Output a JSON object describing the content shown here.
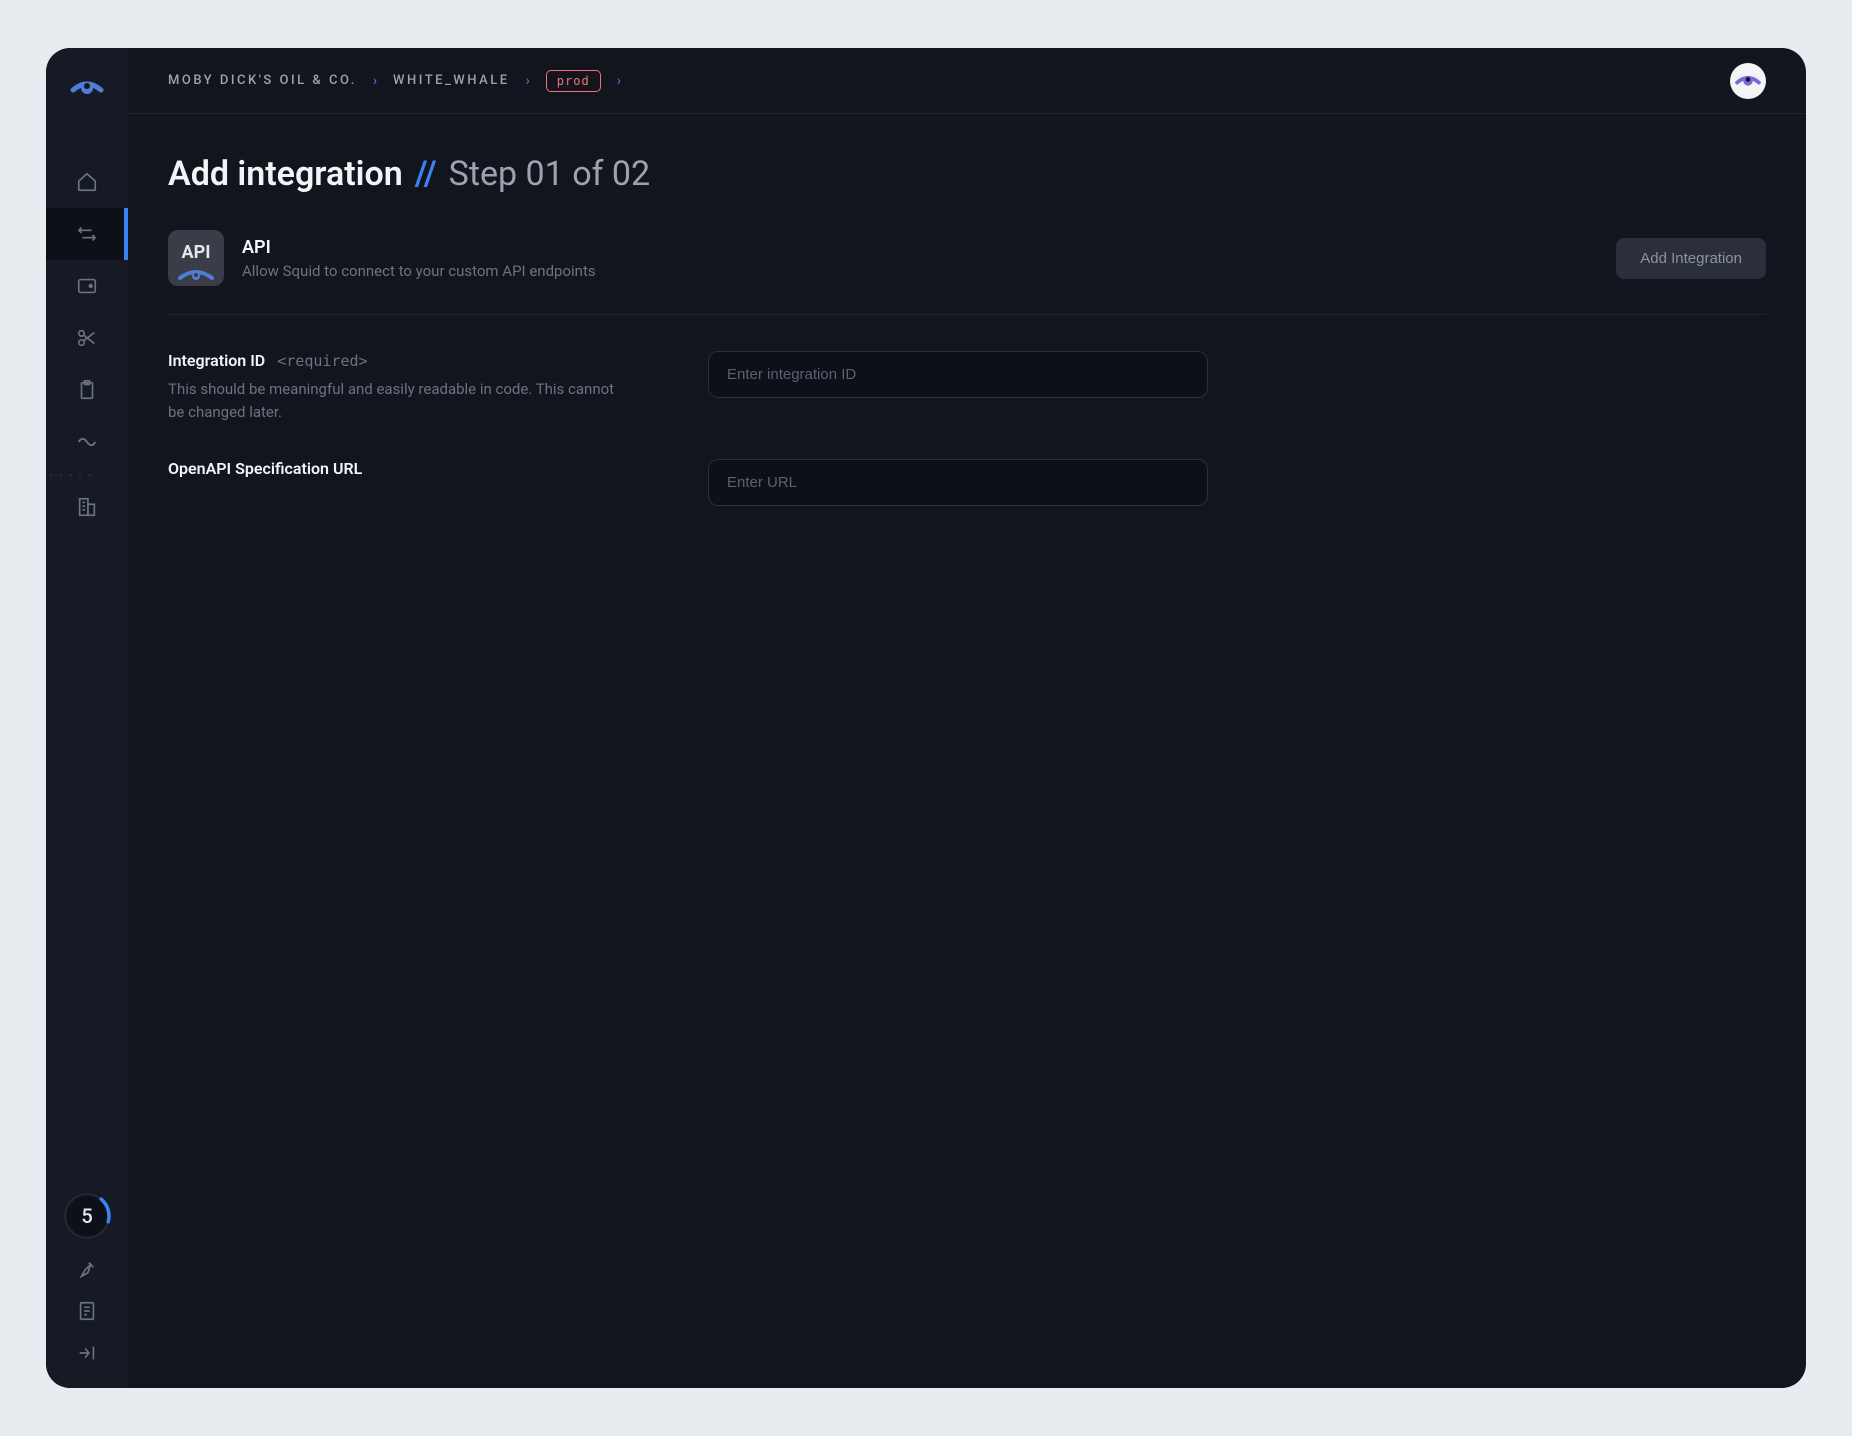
{
  "breadcrumb": {
    "org": "MOBY DICK'S OIL & CO.",
    "project": "WHITE_WHALE",
    "env": "prod"
  },
  "page": {
    "title": "Add integration",
    "step": "Step 01 of 02"
  },
  "integration": {
    "iconLabel": "API",
    "name": "API",
    "description": "Allow Squid to connect to your custom API endpoints",
    "addButton": "Add Integration"
  },
  "fields": {
    "integrationId": {
      "label": "Integration ID",
      "required": "<required>",
      "description": "This should be meaningful and easily readable in code. This cannot be changed later.",
      "placeholder": "Enter integration ID"
    },
    "openApiUrl": {
      "label": "OpenAPI Specification URL",
      "placeholder": "Enter URL"
    }
  },
  "sidebar": {
    "progressBadge": "5"
  }
}
